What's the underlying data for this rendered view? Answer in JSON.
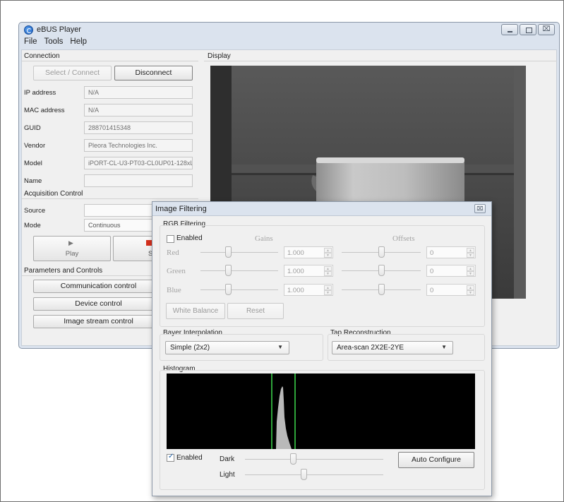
{
  "window": {
    "title": "eBUS Player",
    "menu": [
      "File",
      "Tools",
      "Help"
    ],
    "buttons": {
      "close_glyph": "⌧"
    }
  },
  "connection": {
    "group_label": "Connection",
    "select_label": "Select / Connect",
    "disconnect_label": "Disconnect",
    "fields": [
      {
        "label": "IP address",
        "value": "N/A"
      },
      {
        "label": "MAC address",
        "value": "N/A"
      },
      {
        "label": "GUID",
        "value": "288701415348"
      },
      {
        "label": "Vendor",
        "value": "Pleora Technologies Inc."
      },
      {
        "label": "Model",
        "value": "iPORT-CL-U3-PT03-CL0UP01-128xL"
      },
      {
        "label": "Name",
        "value": ""
      }
    ]
  },
  "acquisition": {
    "group_label": "Acquisition Control",
    "source_label": "Source",
    "source_value": "",
    "mode_label": "Mode",
    "mode_value": "Continuous",
    "play_label": "Play",
    "stop_label": "St"
  },
  "parameters": {
    "group_label": "Parameters and Controls",
    "buttons": [
      "Communication control",
      "Device control",
      "Image stream control"
    ]
  },
  "display": {
    "group_label": "Display"
  },
  "dialog": {
    "title": "Image Filtering",
    "close_glyph": "⌧",
    "rgb": {
      "group_label": "RGB Filtering",
      "enabled_label": "Enabled",
      "enabled": false,
      "gains_header": "Gains",
      "offsets_header": "Offsets",
      "channels": [
        {
          "name": "Red",
          "gain": "1.000",
          "offset": "0"
        },
        {
          "name": "Green",
          "gain": "1.000",
          "offset": "0"
        },
        {
          "name": "Blue",
          "gain": "1.000",
          "offset": "0"
        }
      ],
      "white_balance_label": "White Balance",
      "reset_label": "Reset"
    },
    "bayer": {
      "group_label": "Bayer Interpolation",
      "value": "Simple (2x2)"
    },
    "tap": {
      "group_label": "Tap Reconstruction",
      "value": "Area-scan 2X2E-2YE"
    },
    "histogram": {
      "group_label": "Histogram",
      "enabled_label": "Enabled",
      "enabled": true,
      "dark_label": "Dark",
      "light_label": "Light",
      "auto_configure_label": "Auto Configure"
    }
  },
  "colors": {
    "window_frame": "#dbe3ee",
    "histogram_bounds": "#2ea43a",
    "histogram_fill": "#b9b9b9"
  }
}
